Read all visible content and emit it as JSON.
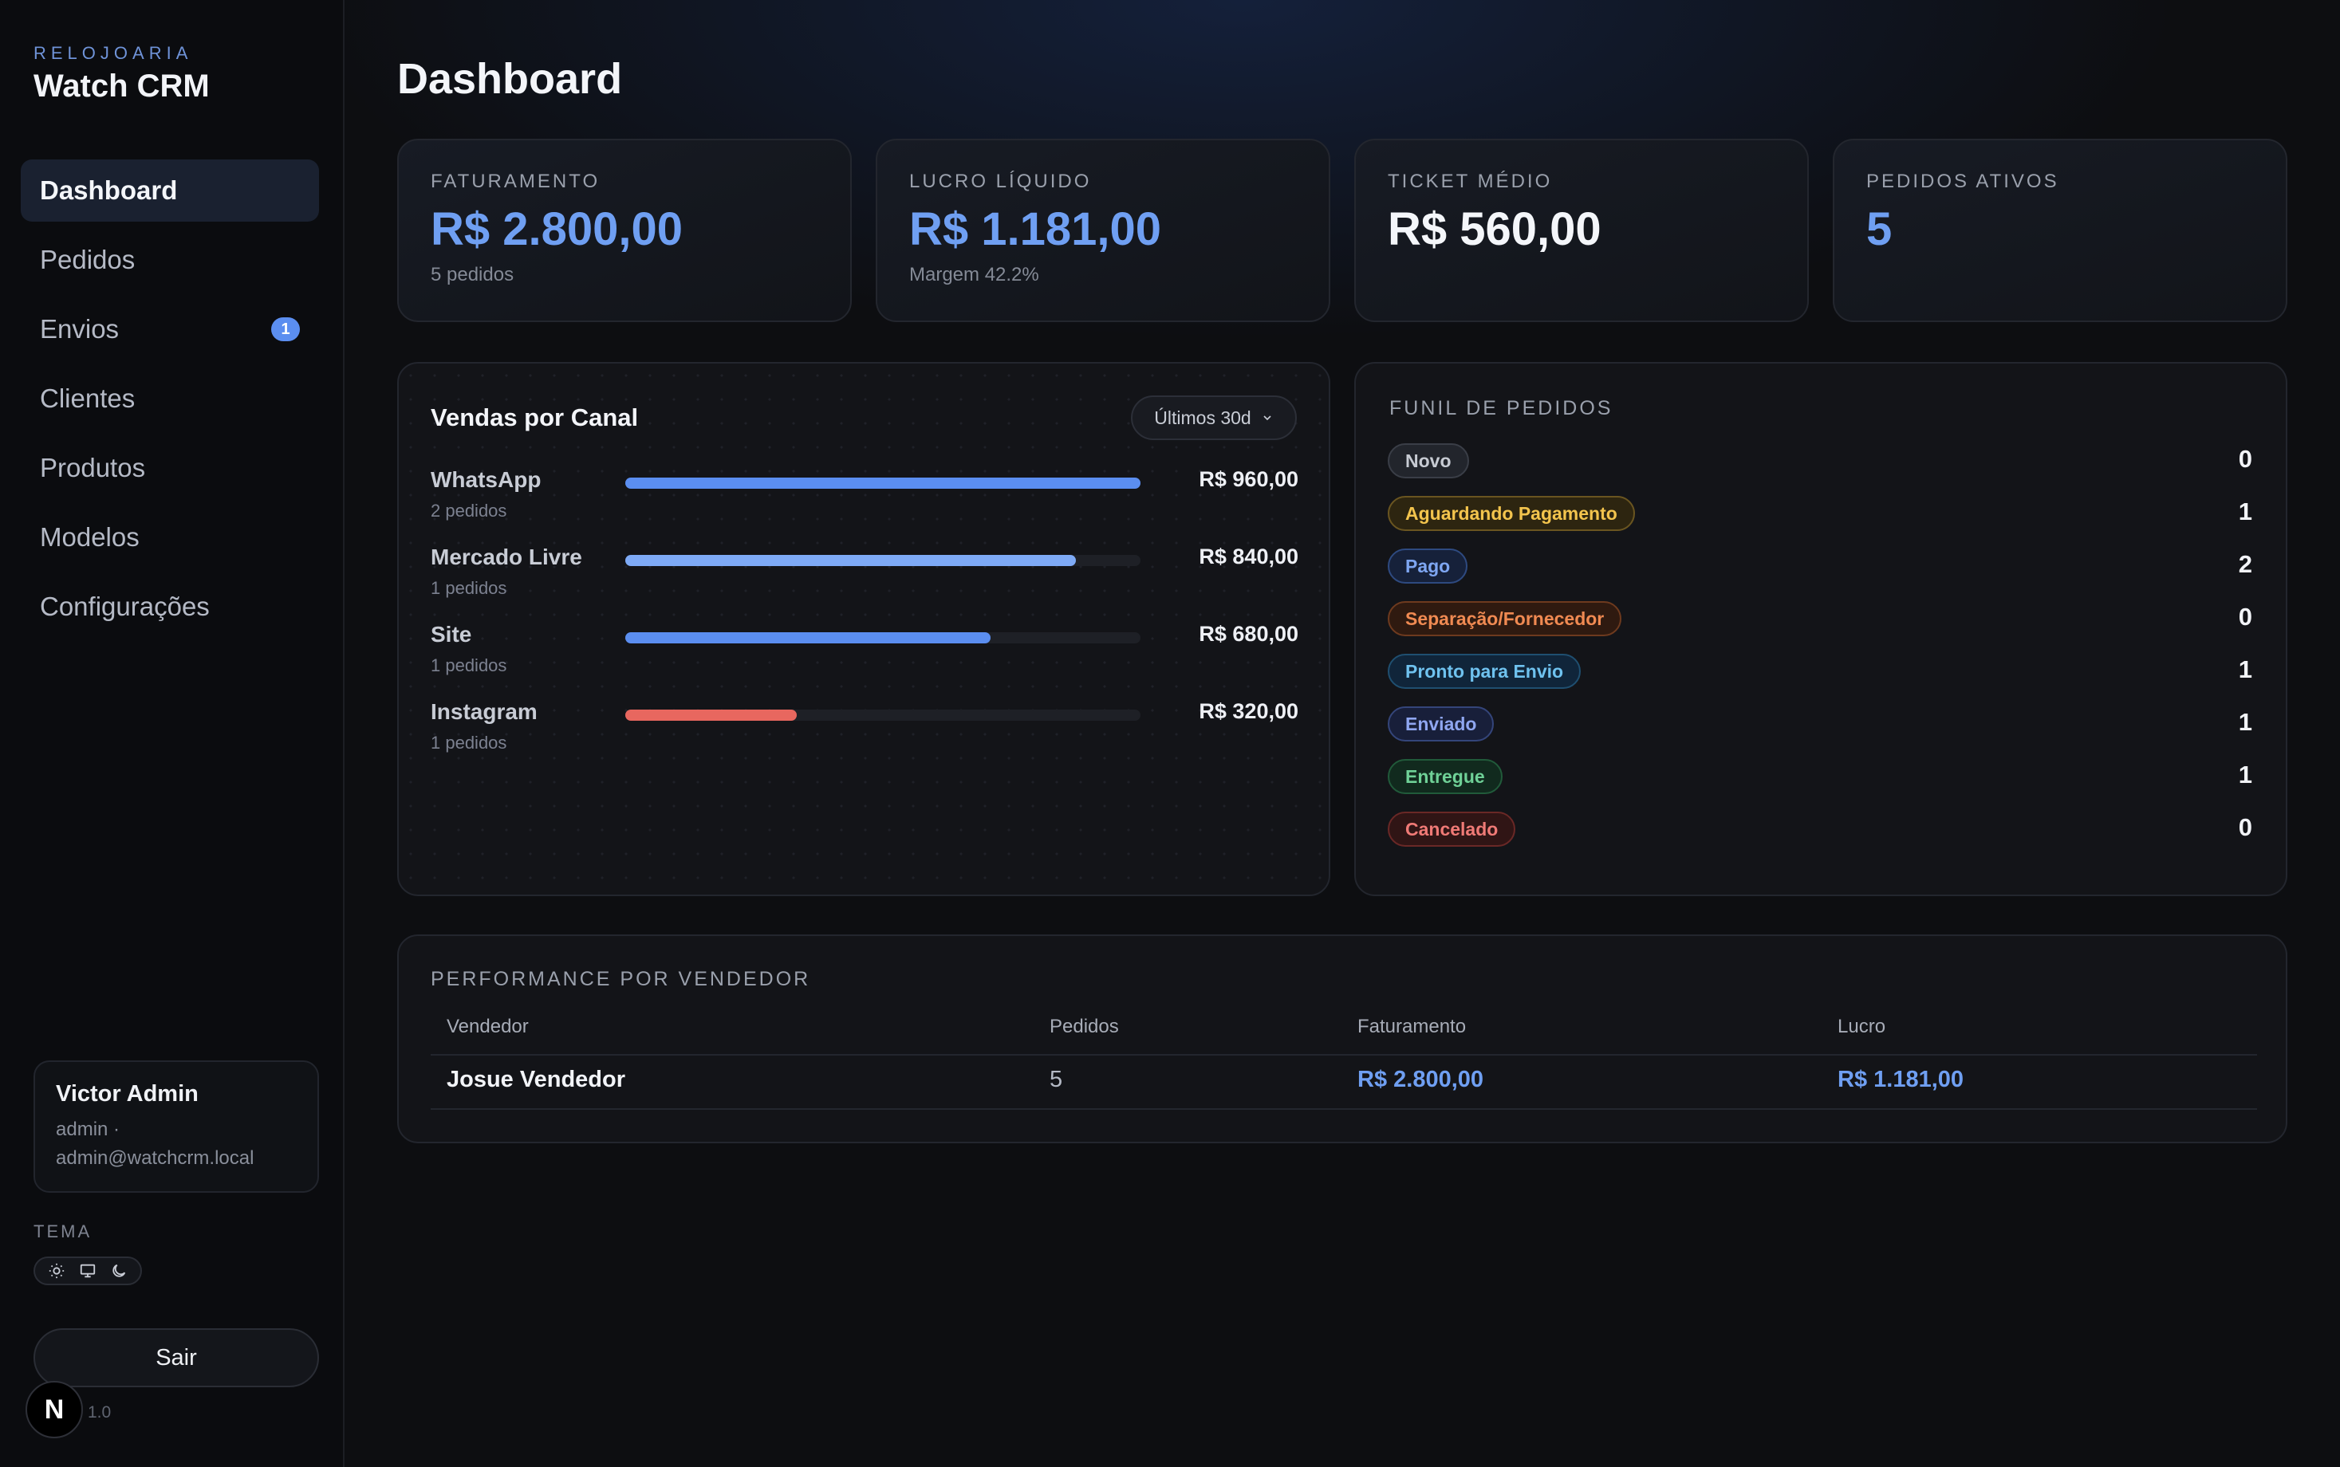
{
  "brand": {
    "kicker": "RELOJOARIA",
    "title": "Watch CRM"
  },
  "nav": [
    {
      "label": "Dashboard",
      "active": true
    },
    {
      "label": "Pedidos"
    },
    {
      "label": "Envios",
      "badge": "1"
    },
    {
      "label": "Clientes"
    },
    {
      "label": "Produtos"
    },
    {
      "label": "Modelos"
    },
    {
      "label": "Configurações"
    }
  ],
  "user": {
    "name": "Victor Admin",
    "role": "admin ·",
    "email": "admin@watchcrm.local"
  },
  "theme": {
    "label": "TEMA",
    "options": [
      "sun-icon",
      "monitor-icon",
      "moon-icon"
    ]
  },
  "logout_label": "Sair",
  "version": "1.0",
  "page_title": "Dashboard",
  "kpis": [
    {
      "label": "FATURAMENTO",
      "value": "R$ 2.800,00",
      "sub": "5 pedidos",
      "accent": "#6f9ff2"
    },
    {
      "label": "LUCRO LÍQUIDO",
      "value": "R$ 1.181,00",
      "sub": "Margem 42.2%",
      "accent": "#6f9ff2"
    },
    {
      "label": "TICKET MÉDIO",
      "value": "R$ 560,00",
      "sub": "",
      "accent": "#f4f6fa"
    },
    {
      "label": "PEDIDOS ATIVOS",
      "value": "5",
      "sub": "",
      "accent": "#6f9ff2"
    }
  ],
  "sales": {
    "title": "Vendas por Canal",
    "range": "Últimos 30d",
    "channels": [
      {
        "name": "WhatsApp",
        "orders": "2 pedidos",
        "amount": "R$ 960,00",
        "value": 960,
        "color": "#5b8ef0"
      },
      {
        "name": "Mercado Livre",
        "orders": "1 pedidos",
        "amount": "R$ 840,00",
        "value": 840,
        "color": "#7eaaf6"
      },
      {
        "name": "Site",
        "orders": "1 pedidos",
        "amount": "R$ 680,00",
        "value": 680,
        "color": "#5b8ef0"
      },
      {
        "name": "Instagram",
        "orders": "1 pedidos",
        "amount": "R$ 320,00",
        "value": 320,
        "color": "#e8675f"
      }
    ]
  },
  "funnel": {
    "title": "FUNIL DE PEDIDOS",
    "stages": [
      {
        "label": "Novo",
        "count": "0",
        "fg": "#c7cbd3",
        "bg": "#22252c",
        "border": "#3a3e47"
      },
      {
        "label": "Aguardando Pagamento",
        "count": "1",
        "fg": "#f3c44d",
        "bg": "#2d2510",
        "border": "#6a5520"
      },
      {
        "label": "Pago",
        "count": "2",
        "fg": "#7ea6f2",
        "bg": "#16213a",
        "border": "#2e4a80"
      },
      {
        "label": "Separação/Fornecedor",
        "count": "0",
        "fg": "#f08a52",
        "bg": "#2f1a10",
        "border": "#6e3a1e"
      },
      {
        "label": "Pronto para Envio",
        "count": "1",
        "fg": "#6fc2ef",
        "bg": "#10253a",
        "border": "#1f4f70"
      },
      {
        "label": "Enviado",
        "count": "1",
        "fg": "#8fa6f0",
        "bg": "#181f3a",
        "border": "#34457a"
      },
      {
        "label": "Entregue",
        "count": "1",
        "fg": "#6fd197",
        "bg": "#112a1e",
        "border": "#215a3a"
      },
      {
        "label": "Cancelado",
        "count": "0",
        "fg": "#ef7a76",
        "bg": "#301515",
        "border": "#6a2826"
      }
    ]
  },
  "performance": {
    "title": "PERFORMANCE POR VENDEDOR",
    "columns": [
      "Vendedor",
      "Pedidos",
      "Faturamento",
      "Lucro"
    ],
    "rows": [
      {
        "seller": "Josue Vendedor",
        "orders": "5",
        "revenue": "R$ 2.800,00",
        "profit": "R$ 1.181,00"
      }
    ]
  }
}
